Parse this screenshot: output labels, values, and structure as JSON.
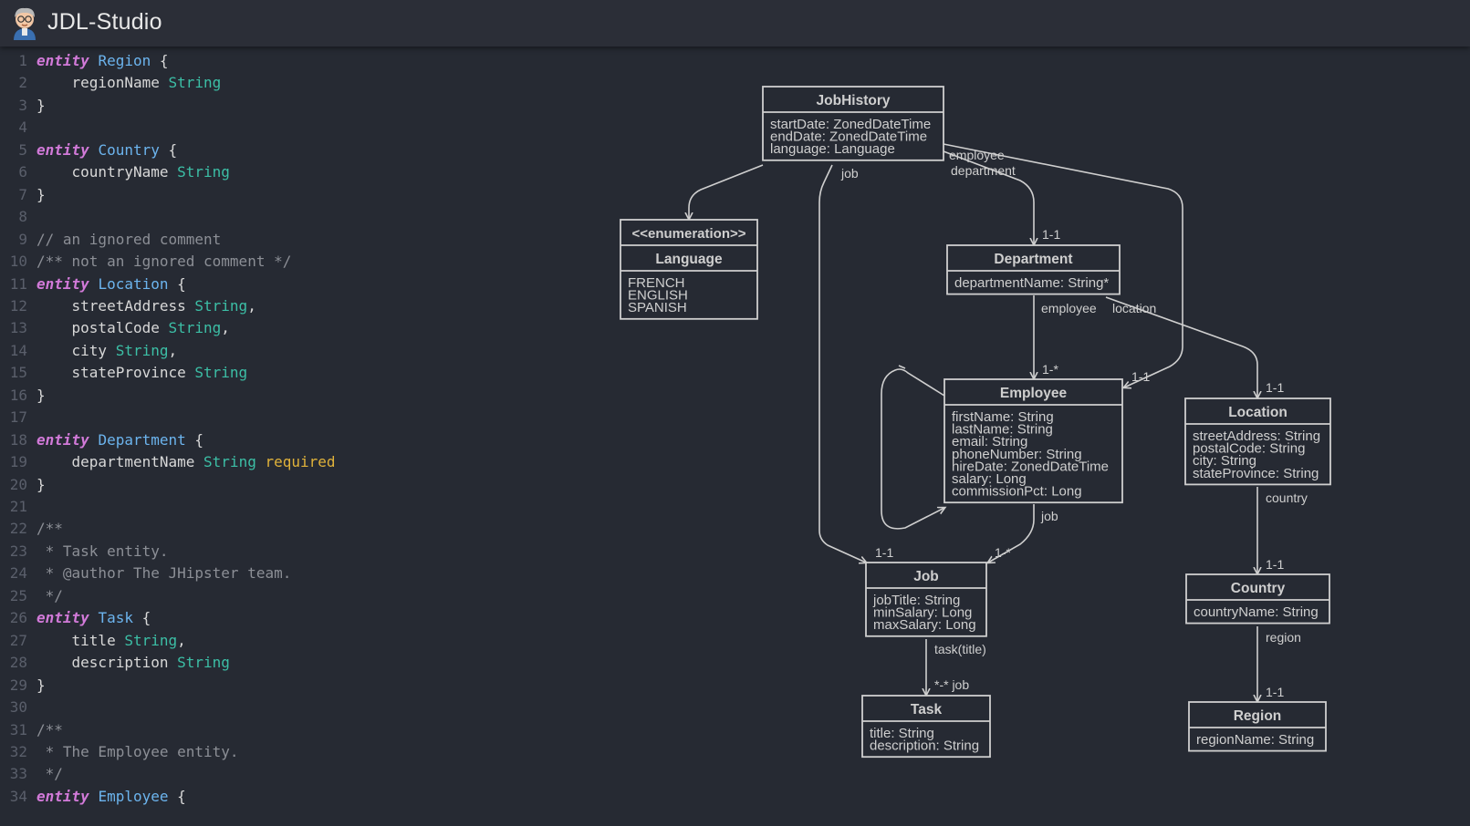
{
  "app": {
    "title": "JDL-Studio",
    "logo_icon": "jhipster-avatar-icon"
  },
  "colors": {
    "background": "#262a33",
    "keyword": "#d27ad9",
    "entity_name": "#6cb4ee",
    "type": "#3cbfa6",
    "validation": "#e0b23a",
    "comment": "#8c8f96",
    "diagram_stroke": "#cfcfcf"
  },
  "editor": {
    "lines": [
      {
        "n": "1",
        "text": "entity Region {"
      },
      {
        "n": "2",
        "text": "    regionName String"
      },
      {
        "n": "3",
        "text": "}"
      },
      {
        "n": "4",
        "text": ""
      },
      {
        "n": "5",
        "text": "entity Country {"
      },
      {
        "n": "6",
        "text": "    countryName String"
      },
      {
        "n": "7",
        "text": "}"
      },
      {
        "n": "8",
        "text": ""
      },
      {
        "n": "9",
        "text": "// an ignored comment"
      },
      {
        "n": "10",
        "text": "/** not an ignored comment */"
      },
      {
        "n": "11",
        "text": "entity Location {"
      },
      {
        "n": "12",
        "text": "    streetAddress String,"
      },
      {
        "n": "13",
        "text": "    postalCode String,"
      },
      {
        "n": "14",
        "text": "    city String,"
      },
      {
        "n": "15",
        "text": "    stateProvince String"
      },
      {
        "n": "16",
        "text": "}"
      },
      {
        "n": "17",
        "text": ""
      },
      {
        "n": "18",
        "text": "entity Department {"
      },
      {
        "n": "19",
        "text": "    departmentName String required"
      },
      {
        "n": "20",
        "text": "}"
      },
      {
        "n": "21",
        "text": ""
      },
      {
        "n": "22",
        "text": "/**"
      },
      {
        "n": "23",
        "text": " * Task entity."
      },
      {
        "n": "24",
        "text": " * @author The JHipster team."
      },
      {
        "n": "25",
        "text": " */"
      },
      {
        "n": "26",
        "text": "entity Task {"
      },
      {
        "n": "27",
        "text": "    title String,"
      },
      {
        "n": "28",
        "text": "    description String"
      },
      {
        "n": "29",
        "text": "}"
      },
      {
        "n": "30",
        "text": ""
      },
      {
        "n": "31",
        "text": "/**"
      },
      {
        "n": "32",
        "text": " * The Employee entity."
      },
      {
        "n": "33",
        "text": " */"
      },
      {
        "n": "34",
        "text": "entity Employee {"
      }
    ]
  },
  "diagram": {
    "entities": [
      {
        "id": "jobhistory",
        "title": "JobHistory",
        "fields": [
          "startDate: ZonedDateTime",
          "endDate: ZonedDateTime",
          "language: Language"
        ]
      },
      {
        "id": "language",
        "stereotype": "<<enumeration>>",
        "title": "Language",
        "fields": [
          "FRENCH",
          "ENGLISH",
          "SPANISH"
        ]
      },
      {
        "id": "department",
        "title": "Department",
        "fields": [
          "departmentName: String*"
        ]
      },
      {
        "id": "employee",
        "title": "Employee",
        "fields": [
          "firstName: String",
          "lastName: String",
          "email: String",
          "phoneNumber: String",
          "hireDate: ZonedDateTime",
          "salary: Long",
          "commissionPct: Long"
        ]
      },
      {
        "id": "location",
        "title": "Location",
        "fields": [
          "streetAddress: String",
          "postalCode: String",
          "city: String",
          "stateProvince: String"
        ]
      },
      {
        "id": "job",
        "title": "Job",
        "fields": [
          "jobTitle: String",
          "minSalary: Long",
          "maxSalary: Long"
        ]
      },
      {
        "id": "country",
        "title": "Country",
        "fields": [
          "countryName: String"
        ]
      },
      {
        "id": "task",
        "title": "Task",
        "fields": [
          "title: String",
          "description: String"
        ]
      },
      {
        "id": "region",
        "title": "Region",
        "fields": [
          "regionName: String"
        ]
      }
    ],
    "labels": [
      {
        "id": "job",
        "text": "job"
      },
      {
        "id": "employee-jh",
        "text": "employee"
      },
      {
        "id": "department-jh",
        "text": "department"
      },
      {
        "id": "dept-1-1",
        "text": "1-1"
      },
      {
        "id": "employee-dept",
        "text": "employee"
      },
      {
        "id": "location-dept",
        "text": "location"
      },
      {
        "id": "emp-1-many",
        "text": "1-*"
      },
      {
        "id": "emp-1-1",
        "text": "1-1"
      },
      {
        "id": "loc-1-1",
        "text": "1-1"
      },
      {
        "id": "job-emp",
        "text": "job"
      },
      {
        "id": "job-1-1",
        "text": "1-1"
      },
      {
        "id": "job-1-many",
        "text": "1-*"
      },
      {
        "id": "country-loc",
        "text": "country"
      },
      {
        "id": "country-1-1",
        "text": "1-1"
      },
      {
        "id": "task-title",
        "text": "task(title)"
      },
      {
        "id": "task-many",
        "text": "*-* job"
      },
      {
        "id": "region-country",
        "text": "region"
      },
      {
        "id": "region-1-1",
        "text": "1-1"
      }
    ]
  }
}
